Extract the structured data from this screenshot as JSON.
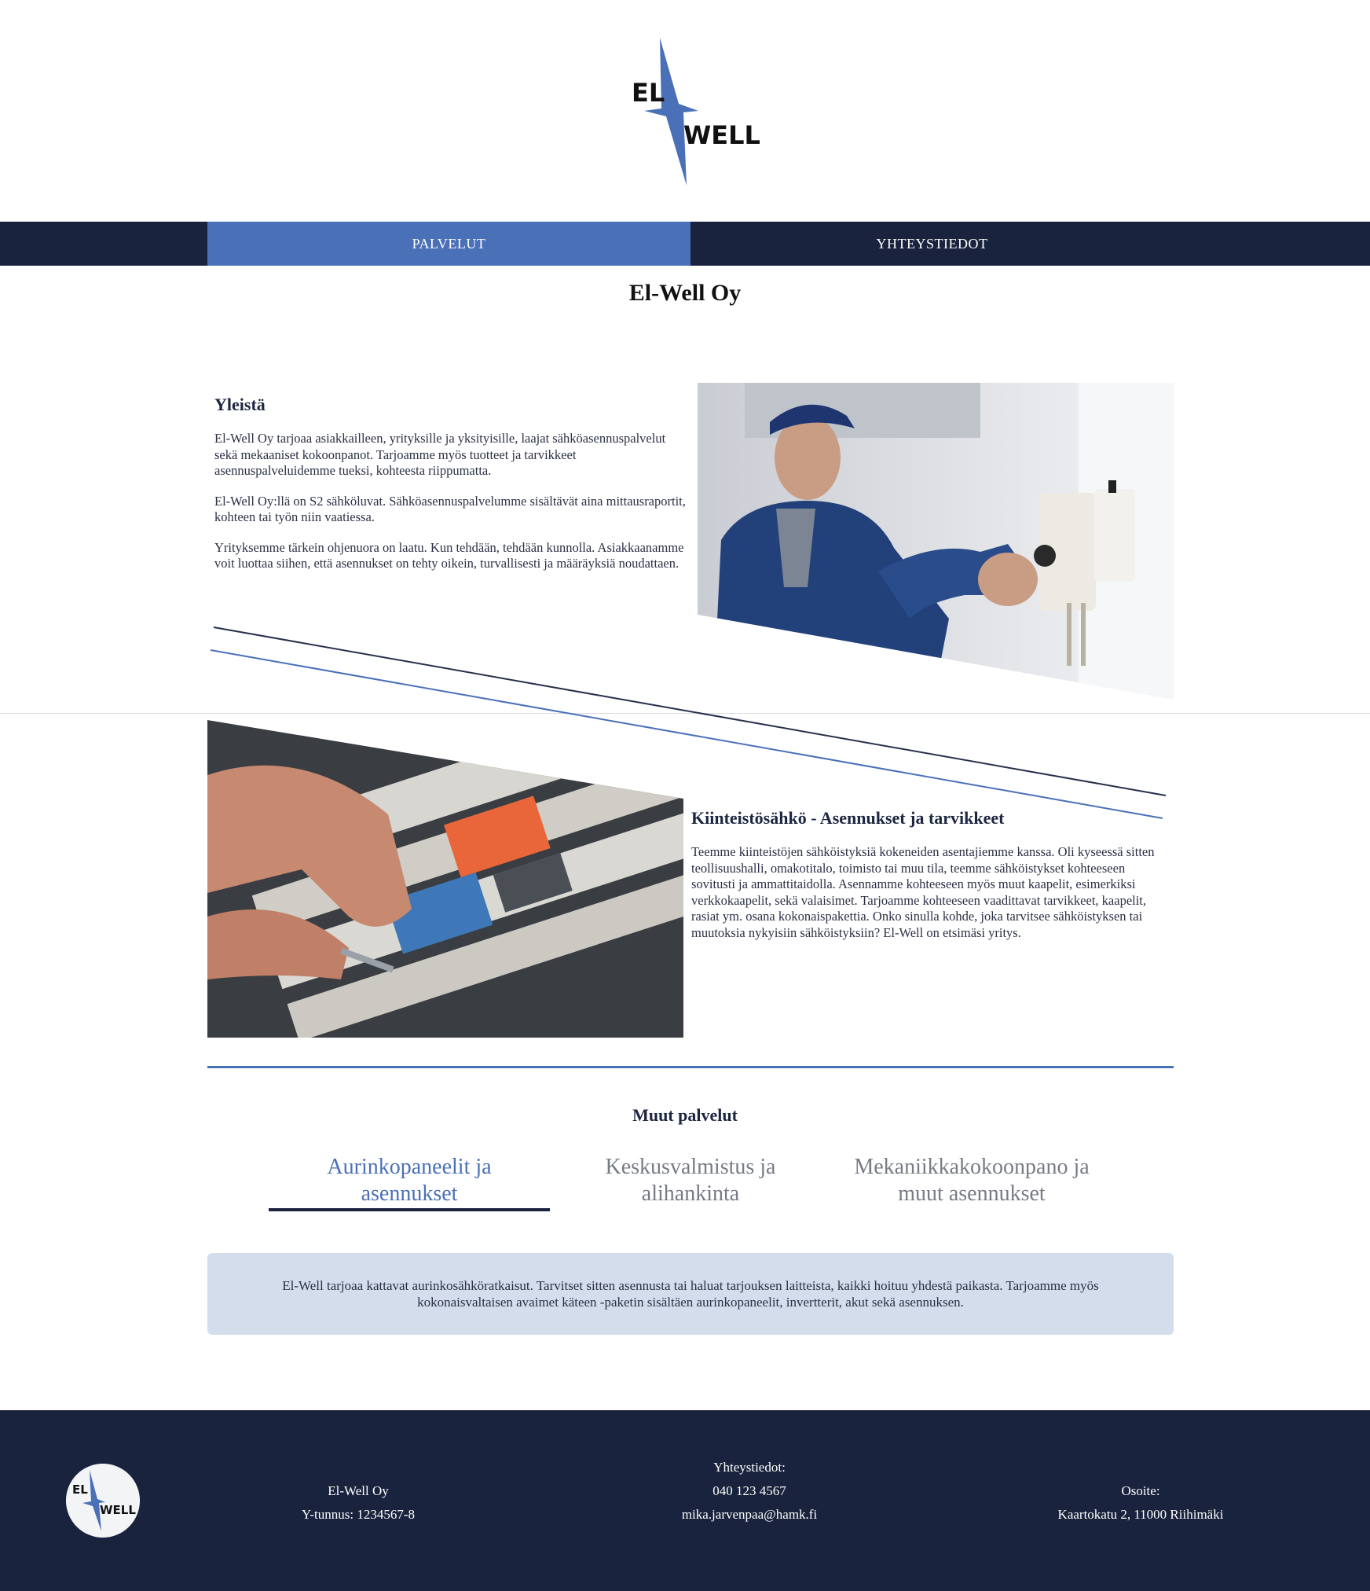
{
  "logo": {
    "line1": "EL",
    "line2": "WELL",
    "colors": {
      "bolt": "#4a70b8",
      "text": "#111111"
    }
  },
  "nav": {
    "items": [
      {
        "label": "PALVELUT",
        "active": true
      },
      {
        "label": "YHTEYSTIEDOT",
        "active": false
      }
    ]
  },
  "page_title": "El-Well Oy",
  "yleista": {
    "heading": "Yleistä",
    "paragraphs": [
      "El-Well Oy tarjoaa asiakkailleen, yrityksille ja yksityisille, laajat sähköasennuspalvelut sekä mekaaniset kokoonpanot. Tarjoamme myös tuotteet ja tarvikkeet asennuspalveluidemme tueksi, kohteesta riippumatta.",
      "El-Well Oy:llä on S2 sähköluvat. Sähköasennuspalvelumme sisältävät aina mittausraportit, kohteen tai työn niin vaatiessa.",
      "Yrityksemme tärkein ohjenuora on laatu. Kun tehdään, tehdään kunnolla. Asiakkaanamme voit luottaa siihen, että asennukset on tehty oikein, turvallisesti ja määräyksiä noudattaen."
    ]
  },
  "kiinteisto": {
    "heading": "Kiinteistösähkö - Asennukset ja tarvikkeet",
    "paragraph": "Teemme kiinteistöjen sähköistyksiä kokeneiden asentajiemme kanssa. Oli kyseessä sitten teollisuushalli, omakotitalo, toimisto tai muu tila, teemme sähköistykset kohteeseen sovitusti ja ammattitaidolla. Asennamme kohteeseen myös muut kaapelit, esimerkiksi verkkokaapelit, sekä valaisimet. Tarjoamme kohteeseen vaadittavat tarvikkeet, kaapelit, rasiat ym. osana kokonaispakettia. Onko sinulla kohde, joka tarvitsee sähköistyksen tai muutoksia nykyisiin sähköistyksiin? El-Well on etsimäsi yritys."
  },
  "muut": {
    "heading": "Muut palvelut",
    "tabs": [
      {
        "line1": "Aurinkopaneelit ja",
        "line2": "asennukset",
        "active": true
      },
      {
        "line1": "Keskusvalmistus ja",
        "line2": "alihankinta",
        "active": false
      },
      {
        "line1": "Mekaniikkakokoonpano ja",
        "line2": "muut asennukset",
        "active": false
      }
    ],
    "panel_text": "El-Well tarjoaa kattavat aurinkosähköratkaisut. Tarvitset sitten asennusta tai haluat tarjouksen laitteista, kaikki hoituu yhdestä paikasta. Tarjoamme myös kokonaisvaltaisen avaimet käteen -paketin sisältäen aurinkopaneelit, invertterit, akut sekä asennuksen."
  },
  "footer": {
    "company": {
      "name": "El-Well Oy",
      "ytunnus": "Y-tunnus: 1234567-8"
    },
    "contact": {
      "heading": "Yhteystiedot:",
      "phone": "040 123 4567",
      "email": "mika.jarvenpaa@hamk.fi"
    },
    "address": {
      "heading": "Osoite:",
      "line": "Kaartokatu 2, 11000 Riihimäki"
    }
  },
  "colors": {
    "navy": "#19233d",
    "accent": "#4a70b8",
    "panel": "#d3ddec"
  }
}
